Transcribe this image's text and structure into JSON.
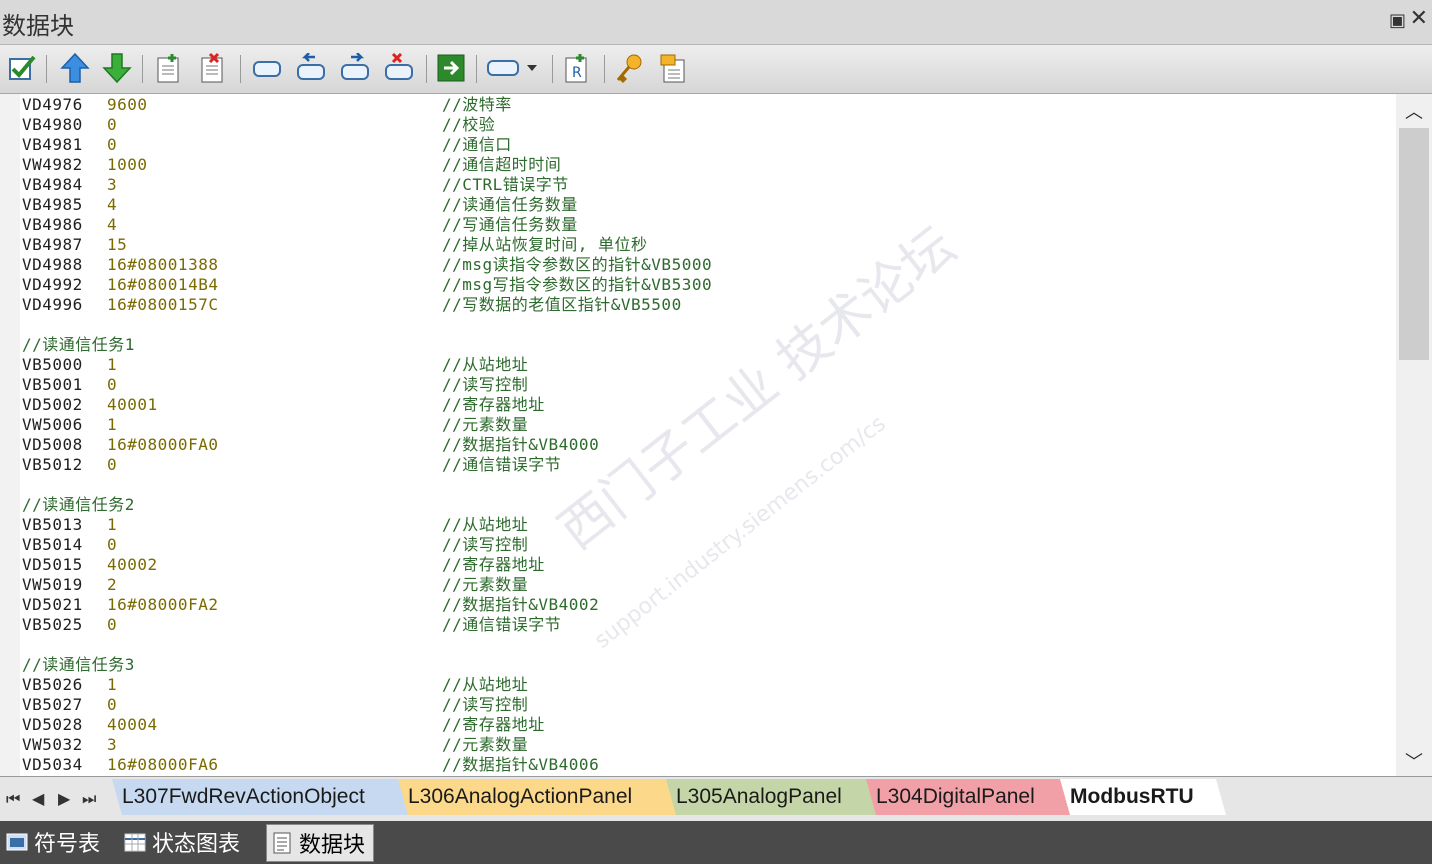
{
  "window": {
    "title": "数据块",
    "pin_glyph": "📌",
    "close_glyph": "✕"
  },
  "toolbar": {
    "buttons": [
      "check-icon",
      "arrow-up-icon",
      "arrow-down-icon",
      "insert-page-icon",
      "delete-page-icon",
      "rounded-rect-icon",
      "undo-icon",
      "redo-icon",
      "clear-icon",
      "go-icon",
      "block-dropdown-icon",
      "dropdown-arrow-icon",
      "insert-r-icon",
      "key-icon",
      "properties-icon"
    ]
  },
  "code_lines": [
    {
      "addr": "VD4976",
      "val": "9600",
      "cmt": "//波特率"
    },
    {
      "addr": "VB4980",
      "val": "0",
      "cmt": "//校验"
    },
    {
      "addr": "VB4981",
      "val": "0",
      "cmt": "//通信口"
    },
    {
      "addr": "VW4982",
      "val": "1000",
      "cmt": "//通信超时时间"
    },
    {
      "addr": "VB4984",
      "val": "3",
      "cmt": "//CTRL错误字节"
    },
    {
      "addr": "VB4985",
      "val": "4",
      "cmt": "//读通信任务数量"
    },
    {
      "addr": "VB4986",
      "val": "4",
      "cmt": "//写通信任务数量"
    },
    {
      "addr": "VB4987",
      "val": "15",
      "cmt": "//掉从站恢复时间, 单位秒"
    },
    {
      "addr": "VD4988",
      "val": "16#08001388",
      "cmt": "//msg读指令参数区的指针&VB5000"
    },
    {
      "addr": "VD4992",
      "val": "16#080014B4",
      "cmt": "//msg写指令参数区的指针&VB5300"
    },
    {
      "addr": "VD4996",
      "val": "16#0800157C",
      "cmt": "//写数据的老值区指针&VB5500"
    },
    {
      "addr": "",
      "val": "",
      "cmt": ""
    },
    {
      "head": "//读通信任务1"
    },
    {
      "addr": "VB5000",
      "val": "1",
      "cmt": "//从站地址"
    },
    {
      "addr": "VB5001",
      "val": "0",
      "cmt": "//读写控制"
    },
    {
      "addr": "VD5002",
      "val": "40001",
      "cmt": "//寄存器地址"
    },
    {
      "addr": "VW5006",
      "val": "1",
      "cmt": "//元素数量"
    },
    {
      "addr": "VD5008",
      "val": "16#08000FA0",
      "cmt": "//数据指针&VB4000"
    },
    {
      "addr": "VB5012",
      "val": "0",
      "cmt": "//通信错误字节"
    },
    {
      "addr": "",
      "val": "",
      "cmt": ""
    },
    {
      "head": "//读通信任务2"
    },
    {
      "addr": "VB5013",
      "val": "1",
      "cmt": "//从站地址"
    },
    {
      "addr": "VB5014",
      "val": "0",
      "cmt": "//读写控制"
    },
    {
      "addr": "VD5015",
      "val": "40002",
      "cmt": "//寄存器地址"
    },
    {
      "addr": "VW5019",
      "val": "2",
      "cmt": "//元素数量"
    },
    {
      "addr": "VD5021",
      "val": "16#08000FA2",
      "cmt": "//数据指针&VB4002"
    },
    {
      "addr": "VB5025",
      "val": "0",
      "cmt": "//通信错误字节"
    },
    {
      "addr": "",
      "val": "",
      "cmt": ""
    },
    {
      "head": "//读通信任务3"
    },
    {
      "addr": "VB5026",
      "val": "1",
      "cmt": "//从站地址"
    },
    {
      "addr": "VB5027",
      "val": "0",
      "cmt": "//读写控制"
    },
    {
      "addr": "VD5028",
      "val": "40004",
      "cmt": "//寄存器地址"
    },
    {
      "addr": "VW5032",
      "val": "3",
      "cmt": "//元素数量"
    },
    {
      "addr": "VD5034",
      "val": "16#08000FA6",
      "cmt": "//数据指针&VB4006"
    }
  ],
  "watermark": {
    "main": "西门子工业 技术论坛",
    "url": "support.industry.siemens.com/cs"
  },
  "scrollbar": {
    "up_glyph": "︿",
    "down_glyph": "﹀"
  },
  "tab_nav": [
    "⏮",
    "◀",
    "▶",
    "⏭"
  ],
  "tabs": [
    {
      "label": "L307FwdRevActionObject",
      "color": "#c6d9f1",
      "active": false
    },
    {
      "label": "L306AnalogActionPanel",
      "color": "#fcd98a",
      "active": false
    },
    {
      "label": "L305AnalogPanel",
      "color": "#c4d6a8",
      "active": false
    },
    {
      "label": "L304DigitalPanel",
      "color": "#f0a0a6",
      "active": false
    },
    {
      "label": "ModbusRTU",
      "color": "#ffffff",
      "active": true
    }
  ],
  "bottom_tabs": [
    {
      "label": "符号表",
      "icon": "symbol-table-icon",
      "active": false
    },
    {
      "label": "状态图表",
      "icon": "status-chart-icon",
      "active": false
    },
    {
      "label": "数据块",
      "icon": "data-block-icon",
      "active": true
    }
  ]
}
